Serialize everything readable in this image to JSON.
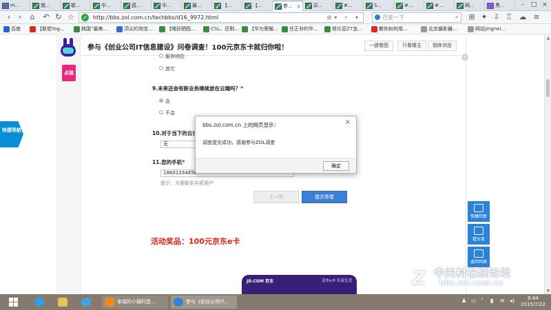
{
  "browser": {
    "tabs": [
      {
        "label": "m..."
      },
      {
        "label": "我..."
      },
      {
        "label": "联..."
      },
      {
        "label": "中..."
      },
      {
        "label": "孤..."
      },
      {
        "label": "中..."
      },
      {
        "label": "最..."
      },
      {
        "label": "【..."
      },
      {
        "label": "【..."
      },
      {
        "label": "参..."
      },
      {
        "label": "买..."
      },
      {
        "label": "#..."
      },
      {
        "label": "S..."
      },
      {
        "label": "#..."
      },
      {
        "label": "#..."
      },
      {
        "label": "网..."
      },
      {
        "label": "黑..."
      }
    ],
    "active_tab_index": 9,
    "url": "http://bbs.zol.com.cn/techbbs/d16_9972.html",
    "search_placeholder": "百度一下",
    "bookmarks": [
      {
        "label": "百度"
      },
      {
        "label": "【联想Yog..."
      },
      {
        "label": "韩国“最美..."
      },
      {
        "label": "顶尖的淘宝..."
      },
      {
        "label": "【嗜好晒图..."
      },
      {
        "label": "CSL、还剩..."
      },
      {
        "label": "【华为荣耀..."
      },
      {
        "label": "任正非的华..."
      },
      {
        "label": "努比亚Z7怎..."
      },
      {
        "label": "教你如何用..."
      },
      {
        "label": "北京摄影器..."
      },
      {
        "label": "网站jingnei..."
      }
    ]
  },
  "page": {
    "banner_title": "参与《创业公司IT信息建设》问卷调查！100元京东卡就归你啦！",
    "banner_buttons": [
      "一键看图",
      "只看楼主",
      "倒序浏览"
    ],
    "dianwo": "点我",
    "side_nav": "快捷导航",
    "q8_options": [
      "服务响应",
      "其它"
    ],
    "q9": {
      "text": "9.未来还会有新业务继续放在云端吗？",
      "required": "*",
      "options": [
        "会",
        "不会"
      ]
    },
    "q10": {
      "text": "10.对于当下的云计",
      "answer": "无"
    },
    "q11": {
      "text": "11.您的手机",
      "required": "*",
      "answer": "18601334856",
      "hint": "提示：方便联系中奖用户"
    },
    "btn_prev": "上一页",
    "btn_submit": "提交答卷",
    "prize": "活动奖品：100元京东e卡",
    "jd_card_left": "JD.COM 京东",
    "jd_card_right": "京东e卡  乐享生活"
  },
  "modal": {
    "title": "bbs.zol.com.cn 上的网页显示：",
    "message": "调查提交成功，感谢参与ZOL调查",
    "ok": "确定"
  },
  "float_panel": [
    "快捷回复",
    "看沙发",
    "返回列表"
  ],
  "watermark": {
    "big": "中关村在线论坛",
    "small": "bbs.zol.com.cn"
  },
  "taskbar": {
    "apps": [
      {
        "label": "幸福的小猫的首..."
      },
      {
        "label": "参与《创业公司IT..."
      }
    ],
    "time": "6:44",
    "date": "2015/7/22"
  },
  "colors": {
    "accent": "#3b7fd6",
    "prize": "#e2231a",
    "dianwo": "#e8287d",
    "side_nav": "#0a8fd6"
  }
}
